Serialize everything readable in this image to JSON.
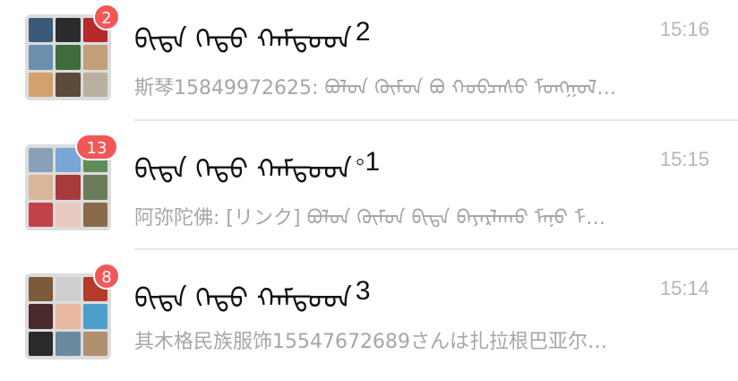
{
  "chats": [
    {
      "title_text": "ᠪᠢᠳᠡ ᠬᠡᠳᠦ ᠬᠠᠮᠲᠤᠳ",
      "title_suffix": "2",
      "time": "15:16",
      "badge": "2",
      "preview": "斯琴15849972625: ᠪᠣᠯᠣᠨ ᠬᠦᠮᠦᠨ ᠪᠣ ᠬᠣᠪᠴᠠᠰᠤ ᠮᠣᠩᠭᠣᠯ…",
      "avatar_colors": [
        "#3b5a7a",
        "#2c2c2c",
        "#b52a2a",
        "#6d8fae",
        "#3f6b3f",
        "#c3a07a",
        "#d2a16e",
        "#5a4a3a",
        "#b9b0a0"
      ]
    },
    {
      "title_text": "ᠪᠢᠳᠡ ᠬᠡᠳᠦ ᠬᠠᠮᠲᠤᠳ",
      "title_suffix": "◦1",
      "time": "15:15",
      "badge": "13",
      "preview": "阿弥陀佛: [リンク] ᠪᠣᠯᠣᠨ ᠬᠦᠮᠦᠨ ᠪᠢᠳᠡ ᠪᠠᠶᠠᠷᠯᠠᠬᠤ ᠮᠠᠨᠤ ᠮ…",
      "avatar_colors": [
        "#8aa0b8",
        "#7aa6d6",
        "#5e8c5a",
        "#d9b79a",
        "#a73a3a",
        "#6b7c5a",
        "#c2424a",
        "#e8c9c1",
        "#8a6a4a"
      ]
    },
    {
      "title_text": "ᠪᠢᠳᠡ ᠬᠡᠳᠦ ᠬᠠᠮᠲᠤᠳ",
      "title_suffix": "3",
      "time": "15:14",
      "badge": "8",
      "preview": "其木格民族服饰15547672689さんは扎拉根巴亚尔…",
      "avatar_colors": [
        "#7d5a3a",
        "#cfcfcf",
        "#b53a2a",
        "#4a2a2a",
        "#e8b9a0",
        "#4aa0c8",
        "#2a2a2a",
        "#6a8aa0",
        "#b09070"
      ]
    }
  ]
}
